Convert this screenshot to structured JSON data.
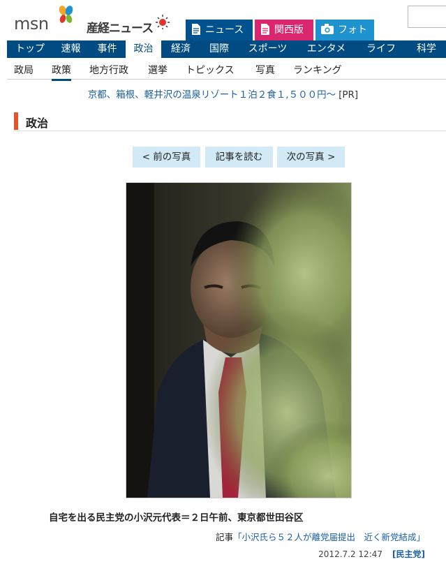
{
  "header": {
    "logo_msn": "msn",
    "logo_sankei": "産経ニュース",
    "tabs": [
      {
        "label": "ニュース",
        "icon": "document-icon",
        "color": "#00528f"
      },
      {
        "label": "関西版",
        "icon": "document-icon",
        "color": "#d9266f"
      },
      {
        "label": "フォト",
        "icon": "camera-icon",
        "color": "#1f93cf"
      }
    ]
  },
  "main_nav": {
    "items": [
      "トップ",
      "速報",
      "事件",
      "政治",
      "経済",
      "国際",
      "スポーツ",
      "エンタメ",
      "ライフ",
      "科学"
    ],
    "active": "政治"
  },
  "sub_nav": {
    "items": [
      "政局",
      "政策",
      "地方行政",
      "選挙",
      "トピックス",
      "写真",
      "ランキング"
    ],
    "active": "政策"
  },
  "ad": {
    "text": "京都、箱根、軽井沢の温泉リゾート１泊２食１,５００円～",
    "pr": "[PR]"
  },
  "section": {
    "title": "政治"
  },
  "pager": {
    "prev": "< 前の写真",
    "article": "記事を読む",
    "next": "次の写真 >"
  },
  "photo": {
    "caption": "自宅を出る民主党の小沢元代表＝２日午前、東京都世田谷区"
  },
  "article": {
    "prefix": "記事",
    "link": "「小沢氏ら５２人が離党届提出　近く新党結成」"
  },
  "meta": {
    "date": "2012.7.2 12:47",
    "tag": "[民主党]"
  },
  "colors": {
    "nav_blue": "#004c82",
    "accent_orange": "#e0552e",
    "link_blue": "#1a5fa3",
    "pager_bg": "#d2eaf5"
  }
}
